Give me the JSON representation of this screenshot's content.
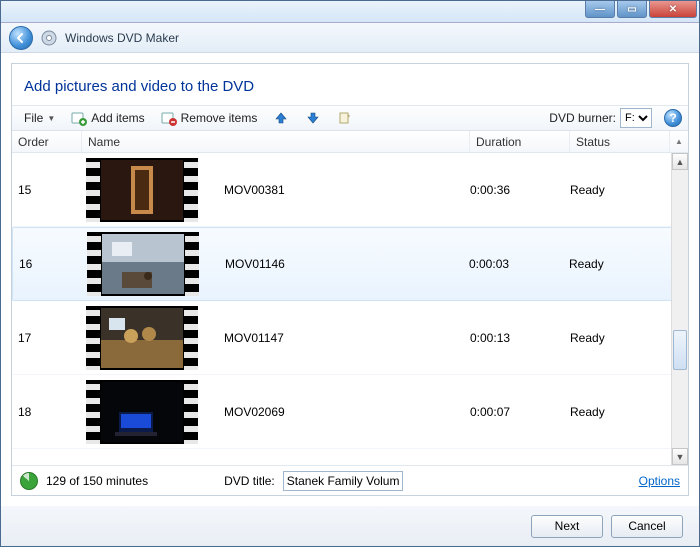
{
  "window": {
    "app_title": "Windows DVD Maker"
  },
  "page": {
    "heading": "Add pictures and video to the DVD"
  },
  "toolbar": {
    "file": "File",
    "add_items": "Add items",
    "remove_items": "Remove items",
    "dvd_burner_label": "DVD burner:",
    "burner_options": [
      "F:"
    ],
    "burner_selected": "F:"
  },
  "columns": {
    "order": "Order",
    "name": "Name",
    "duration": "Duration",
    "status": "Status"
  },
  "items": [
    {
      "order": "15",
      "name": "MOV00381",
      "duration": "0:00:36",
      "status": "Ready",
      "selected": false,
      "thumb": {
        "bg": "#2a1810",
        "accent": "#c88a4a",
        "shape": "door"
      }
    },
    {
      "order": "16",
      "name": "MOV01146",
      "duration": "0:00:03",
      "status": "Ready",
      "selected": true,
      "thumb": {
        "bg": "#6a7a88",
        "accent": "#d8dee4",
        "shape": "room"
      }
    },
    {
      "order": "17",
      "name": "MOV01147",
      "duration": "0:00:13",
      "status": "Ready",
      "selected": false,
      "thumb": {
        "bg": "#3a3228",
        "accent": "#caa15a",
        "shape": "people"
      }
    },
    {
      "order": "18",
      "name": "MOV02069",
      "duration": "0:00:07",
      "status": "Ready",
      "selected": false,
      "thumb": {
        "bg": "#04060a",
        "accent": "#1a4ad8",
        "shape": "laptop"
      }
    }
  ],
  "footer": {
    "capacity_text": "129 of 150 minutes",
    "dvd_title_label": "DVD title:",
    "dvd_title_value": "Stanek Family Volum",
    "options_link": "Options"
  },
  "buttons": {
    "next": "Next",
    "cancel": "Cancel"
  }
}
